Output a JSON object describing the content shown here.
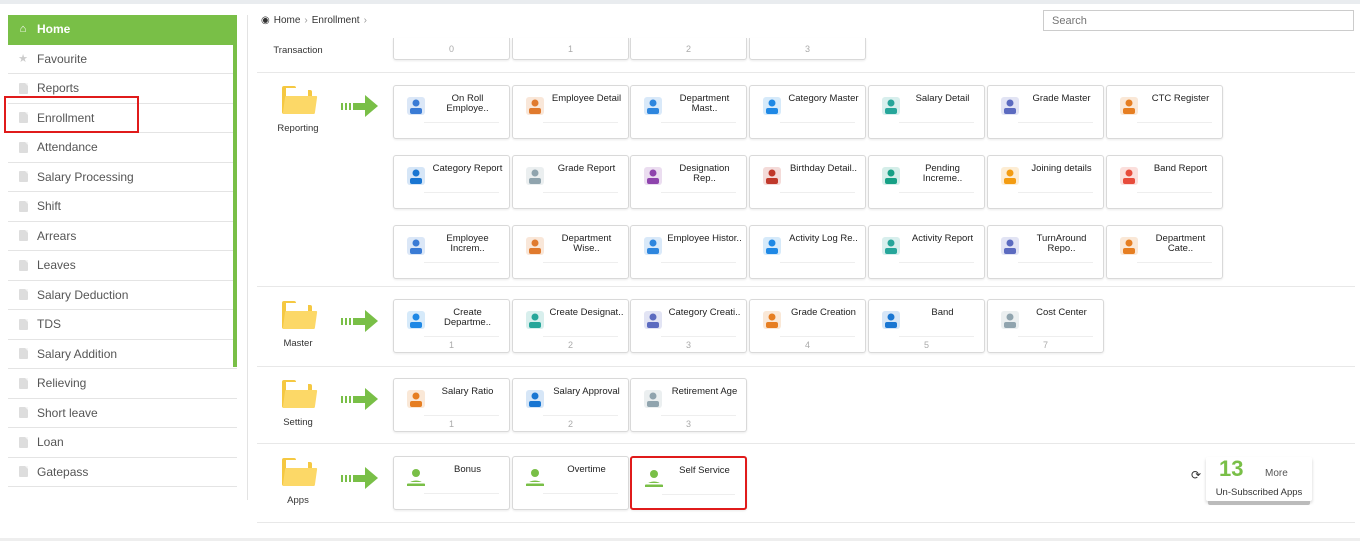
{
  "colors": {
    "accent": "#79bf47",
    "highlight": "#e01b1b",
    "folder": "#f5c842"
  },
  "sidebar": {
    "items": [
      {
        "label": "Home",
        "icon": "home-icon",
        "active": true
      },
      {
        "label": "Favourite",
        "icon": "star-icon"
      },
      {
        "label": "Reports",
        "icon": "document-icon"
      },
      {
        "label": "Enrollment",
        "icon": "document-icon"
      },
      {
        "label": "Attendance",
        "icon": "document-icon"
      },
      {
        "label": "Salary Processing",
        "icon": "document-icon"
      },
      {
        "label": "Shift",
        "icon": "document-icon"
      },
      {
        "label": "Arrears",
        "icon": "document-icon"
      },
      {
        "label": "Leaves",
        "icon": "document-icon"
      },
      {
        "label": "Salary Deduction",
        "icon": "document-icon"
      },
      {
        "label": "TDS",
        "icon": "document-icon"
      },
      {
        "label": "Salary Addition",
        "icon": "document-icon"
      },
      {
        "label": "Relieving",
        "icon": "document-icon"
      },
      {
        "label": "Short leave",
        "icon": "document-icon"
      },
      {
        "label": "Loan",
        "icon": "document-icon"
      },
      {
        "label": "Gatepass",
        "icon": "document-icon"
      }
    ]
  },
  "breadcrumb": {
    "home": "Home",
    "current": "Enrollment"
  },
  "search": {
    "placeholder": "Search"
  },
  "sections": {
    "transaction": {
      "label": "Transaction",
      "cards": [
        {
          "num": "0"
        },
        {
          "num": "1"
        },
        {
          "num": "2"
        },
        {
          "num": "3"
        }
      ]
    },
    "reporting": {
      "label": "Reporting",
      "cards": [
        {
          "title": "On Roll Employe..",
          "icon": "employee-icon"
        },
        {
          "title": "Employee Detail",
          "icon": "employee-detail-icon"
        },
        {
          "title": "Department Mast..",
          "icon": "department-icon"
        },
        {
          "title": "Category Master",
          "icon": "category-icon"
        },
        {
          "title": "Salary Detail",
          "icon": "salary-icon"
        },
        {
          "title": "Grade Master",
          "icon": "grade-icon"
        },
        {
          "title": "CTC Register",
          "icon": "ctc-icon"
        },
        {
          "title": "Category Report",
          "icon": "category-report-icon"
        },
        {
          "title": "Grade Report",
          "icon": "grade-report-icon"
        },
        {
          "title": "Designation Rep..",
          "icon": "designation-icon"
        },
        {
          "title": "Birthday Detail..",
          "icon": "birthday-icon"
        },
        {
          "title": "Pending Increme..",
          "icon": "pending-increment-icon"
        },
        {
          "title": "Joining details",
          "icon": "joining-icon"
        },
        {
          "title": "Band Report",
          "icon": "band-report-icon"
        },
        {
          "title": "Employee Increm..",
          "icon": "increment-icon"
        },
        {
          "title": "Department Wise..",
          "icon": "department-wise-icon"
        },
        {
          "title": "Employee Histor..",
          "icon": "history-icon"
        },
        {
          "title": "Activity Log Re..",
          "icon": "activity-log-icon"
        },
        {
          "title": "Activity Report",
          "icon": "activity-report-icon"
        },
        {
          "title": "TurnAround Repo..",
          "icon": "turnaround-icon"
        },
        {
          "title": "Department Cate..",
          "icon": "department-category-icon"
        }
      ]
    },
    "master": {
      "label": "Master",
      "cards": [
        {
          "title": "Create Departme..",
          "num": "1",
          "icon": "create-department-icon"
        },
        {
          "title": "Create Designat..",
          "num": "2",
          "icon": "create-designation-icon"
        },
        {
          "title": "Category Creati..",
          "num": "3",
          "icon": "category-creation-icon"
        },
        {
          "title": "Grade Creation",
          "num": "4",
          "icon": "grade-creation-icon"
        },
        {
          "title": "Band",
          "num": "5",
          "icon": "band-icon"
        },
        {
          "title": "Cost Center",
          "num": "7",
          "icon": "cost-center-icon"
        }
      ]
    },
    "setting": {
      "label": "Setting",
      "cards": [
        {
          "title": "Salary Ratio",
          "num": "1",
          "icon": "salary-ratio-icon"
        },
        {
          "title": "Salary Approval",
          "num": "2",
          "icon": "salary-approval-icon"
        },
        {
          "title": "Retirement Age",
          "num": "3",
          "icon": "retirement-icon"
        }
      ]
    },
    "apps": {
      "label": "Apps",
      "cards": [
        {
          "title": "Bonus",
          "icon": "person-icon"
        },
        {
          "title": "Overtime",
          "icon": "person-icon"
        },
        {
          "title": "Self Service",
          "icon": "person-icon"
        }
      ]
    }
  },
  "more": {
    "count": "13",
    "word": "More",
    "subtitle": "Un-Subscribed Apps"
  }
}
